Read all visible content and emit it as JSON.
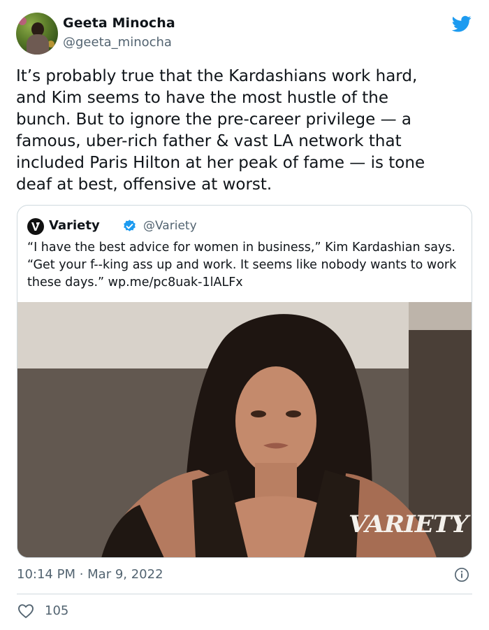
{
  "author": {
    "display_name": "Geeta Minocha",
    "handle": "@geeta_minocha"
  },
  "tweet": {
    "text": "It’s probably true that the Kardashians work hard,\nand Kim seems to have the most hustle of the\nbunch. But to ignore the pre-career privilege — a\nfamous, uber-rich father & vast LA network that\nincluded Paris Hilton at her peak of fame — is tone\ndeaf at best, offensive at worst.",
    "timestamp": "10:14 PM · Mar 9, 2022",
    "likes": "105"
  },
  "quoted_tweet": {
    "display_name": "Variety",
    "handle": "@Variety",
    "text": "“I have the best advice for women in business,” Kim Kardashian says. “Get your f--king ass up and work. It seems like nobody wants to work these days.” wp.me/pc8uak-1lALFx",
    "image_watermark": "VARIETY"
  },
  "icons": {
    "brand": "twitter-bird-icon",
    "verified": "verified-badge-icon",
    "info": "info-icon",
    "like": "heart-icon"
  },
  "colors": {
    "twitter_blue": "#1d9bf0",
    "secondary_text": "#536471",
    "border": "#cfd9de"
  }
}
